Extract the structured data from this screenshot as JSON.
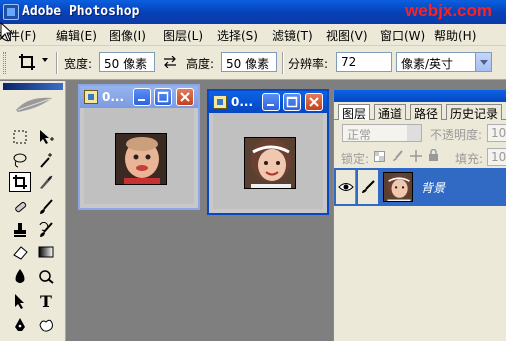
{
  "app": {
    "title": "Adobe Photoshop",
    "watermark": "webjx.com"
  },
  "menu": {
    "items": [
      {
        "label": "文件(F)",
        "name": "menu-file"
      },
      {
        "label": "编辑(E)",
        "name": "menu-edit"
      },
      {
        "label": "图像(I)",
        "name": "menu-image"
      },
      {
        "label": "图层(L)",
        "name": "menu-layer"
      },
      {
        "label": "选择(S)",
        "name": "menu-select"
      },
      {
        "label": "滤镜(T)",
        "name": "menu-filter"
      },
      {
        "label": "视图(V)",
        "name": "menu-view"
      },
      {
        "label": "窗口(W)",
        "name": "menu-window"
      },
      {
        "label": "帮助(H)",
        "name": "menu-help"
      }
    ]
  },
  "options": {
    "width_label": "宽度:",
    "width_value": "50 像素",
    "swap_icon": "swap-arrows-icon",
    "height_label": "高度:",
    "height_value": "50 像素",
    "resolution_label": "分辨率:",
    "resolution_value": "72",
    "resolution_unit": "像素/英寸"
  },
  "toolbox": {
    "tools": [
      "marquee-icon",
      "move-icon",
      "lasso-icon",
      "magic-wand-icon",
      "crop-icon",
      "slice-icon",
      "healing-brush-icon",
      "brush-icon",
      "clone-stamp-icon",
      "history-brush-icon",
      "eraser-icon",
      "gradient-icon",
      "blur-icon",
      "dodge-icon",
      "path-selection-icon",
      "type-tool",
      "pen-icon",
      "custom-shape-icon"
    ],
    "type_tool_label": "T",
    "active_tool": "crop-icon"
  },
  "documents": [
    {
      "title": "0...",
      "state": "inactive"
    },
    {
      "title": "0...",
      "state": "active"
    }
  ],
  "layers_panel": {
    "tabs": [
      "图层",
      "通道",
      "路径",
      "历史记录"
    ],
    "active_tab": "图层",
    "blend_mode": "正常",
    "opacity_label": "不透明度:",
    "opacity_value": "100",
    "lock_label": "锁定:",
    "fill_label": "填充:",
    "fill_value": "100",
    "layer_name": "背景"
  },
  "colors": {
    "titlebar": "#0846c0",
    "selection": "#316ac5",
    "watermark": "#ff2020",
    "workspace": "#7f7f7f"
  }
}
